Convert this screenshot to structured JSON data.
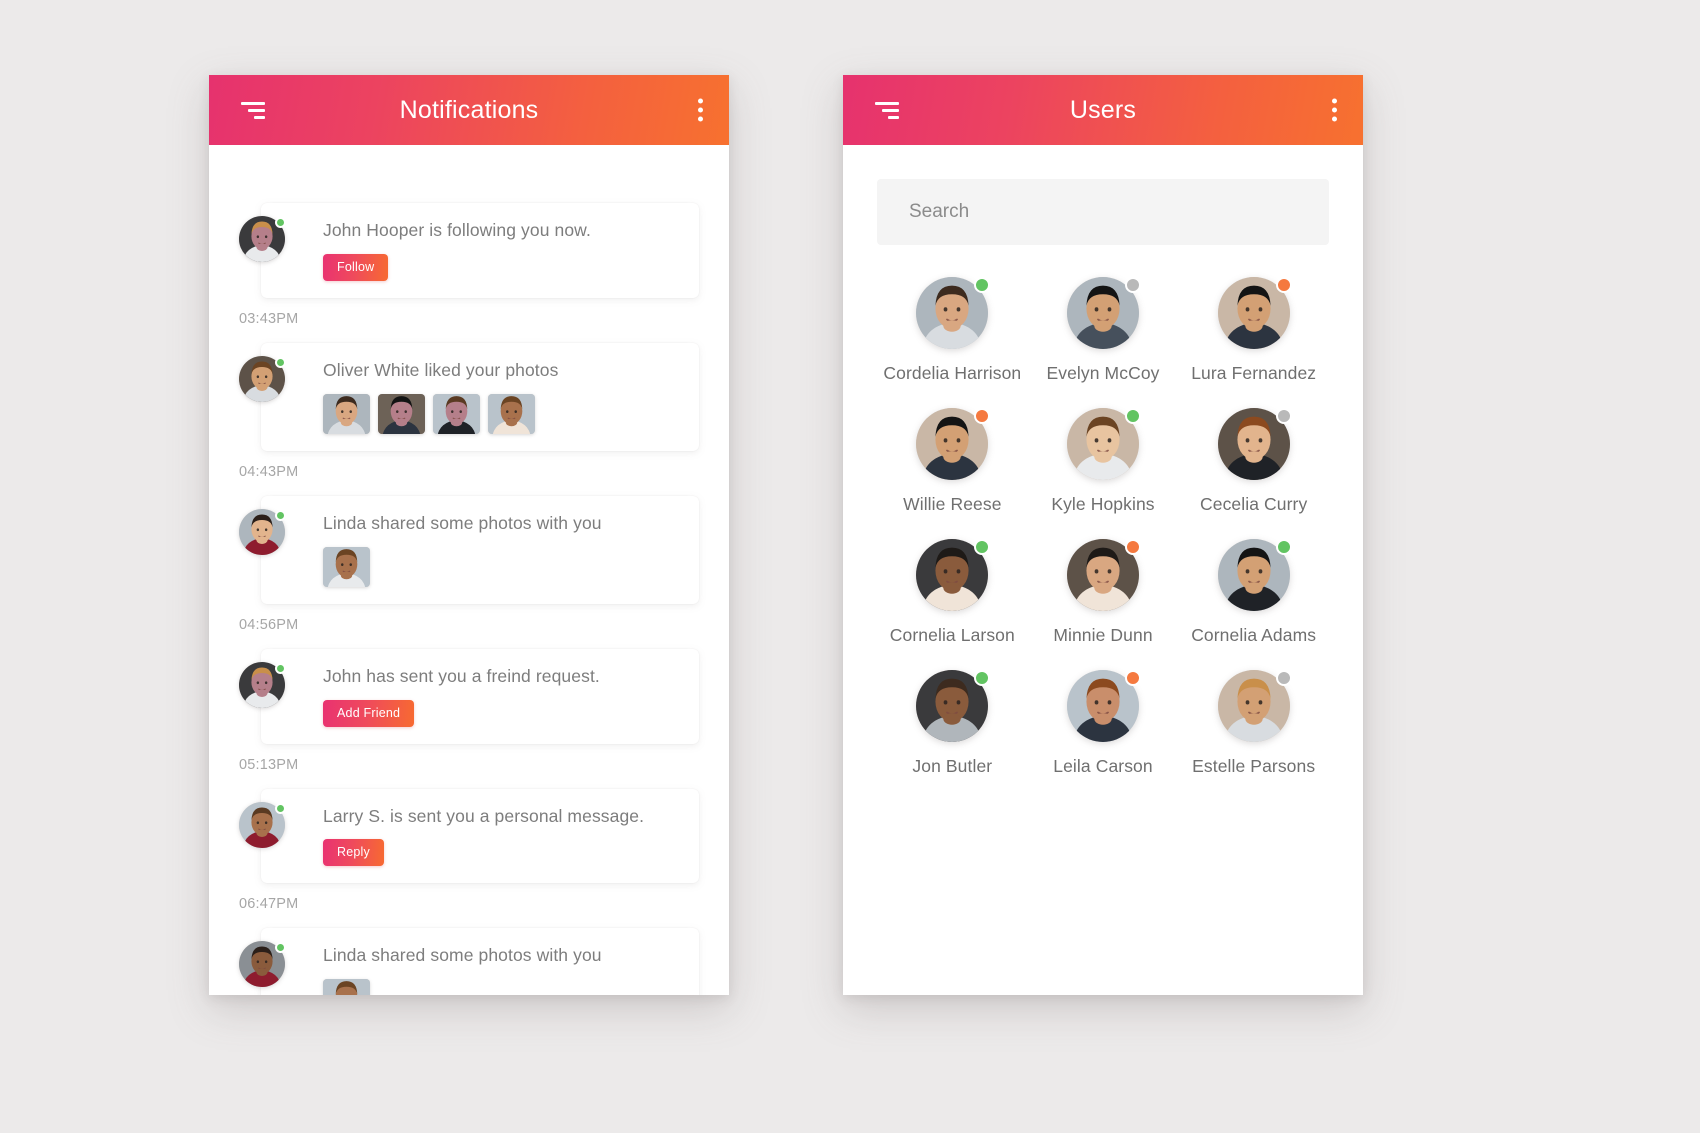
{
  "colors": {
    "gradient_start": "#e6326e",
    "gradient_end": "#f7712f",
    "status_online": "#62c462",
    "status_away": "#f5793f",
    "status_offline": "#b9b9b9",
    "text_muted": "#7d7d7d",
    "page_background": "#eceaea"
  },
  "notifications_screen": {
    "title": "Notifications",
    "menu_icon": "hamburger-icon",
    "overflow_icon": "more-vertical-icon",
    "items": [
      {
        "text": "John Hooper is following you now.",
        "action": "Follow",
        "time": "03:43PM",
        "status": "online",
        "avatar": "male-short-hair",
        "photos": []
      },
      {
        "text": "Oliver White liked your photos",
        "action": "",
        "time": "04:43PM",
        "status": "online",
        "avatar": "female-red-hair",
        "photos": [
          "man-pink-shirt",
          "woman-dark-hair",
          "man-beard-coat",
          "woman-hood"
        ]
      },
      {
        "text": "Linda shared some photos with you",
        "action": "",
        "time": "04:56PM",
        "status": "online",
        "avatar": "woman-scarf",
        "photos": [
          "woman-white-shirt"
        ]
      },
      {
        "text": "John has sent you a freind request.",
        "action": "Add Friend",
        "time": "05:13PM",
        "status": "online",
        "avatar": "male-short-hair",
        "photos": []
      },
      {
        "text": "Larry S. is sent you a personal message.",
        "action": "Reply",
        "time": "06:47PM",
        "status": "online",
        "avatar": "woman-red-lips",
        "photos": []
      },
      {
        "text": "Linda shared some photos with you",
        "action": "",
        "time": "",
        "status": "online",
        "avatar": "woman-long-hair",
        "photos": [
          "woman-white-shirt"
        ]
      }
    ]
  },
  "users_screen": {
    "title": "Users",
    "menu_icon": "hamburger-icon",
    "overflow_icon": "more-vertical-icon",
    "search": {
      "placeholder": "Search",
      "value": ""
    },
    "users": [
      {
        "name": "Cordelia Harrison",
        "status": "online",
        "avatar": "woman-red-top"
      },
      {
        "name": "Evelyn McCoy",
        "status": "offline",
        "avatar": "man-white-vneck"
      },
      {
        "name": "Lura Fernandez",
        "status": "away",
        "avatar": "woman-brown-hair"
      },
      {
        "name": "Willie Reese",
        "status": "away",
        "avatar": "woman-ginger-hair"
      },
      {
        "name": "Kyle Hopkins",
        "status": "online",
        "avatar": "woman-striped-top"
      },
      {
        "name": "Cecelia Curry",
        "status": "offline",
        "avatar": "woman-dark-closeup"
      },
      {
        "name": "Cornelia Larson",
        "status": "online",
        "avatar": "woman-blonde"
      },
      {
        "name": "Minnie Dunn",
        "status": "away",
        "avatar": "woman-white-blouse"
      },
      {
        "name": "Cornelia Adams",
        "status": "online",
        "avatar": "woman-short-hair"
      },
      {
        "name": "Jon Butler",
        "status": "online",
        "avatar": "man-curly-hair"
      },
      {
        "name": "Leila Carson",
        "status": "away",
        "avatar": "woman-curly-dark"
      },
      {
        "name": "Estelle Parsons",
        "status": "offline",
        "avatar": "woman-freckles"
      }
    ]
  }
}
